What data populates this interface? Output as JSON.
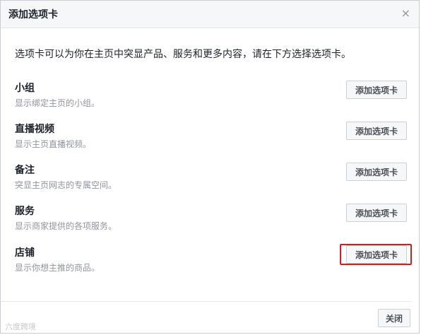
{
  "dialog": {
    "title": "添加选项卡",
    "close_glyph": "×",
    "intro": "选项卡可以为你在主页中突显产品、服务和更多内容，请在下方选择选项卡。",
    "tabs": [
      {
        "title": "小组",
        "description": "显示绑定主页的小组。",
        "button": "添加选项卡"
      },
      {
        "title": "直播视频",
        "description": "显示主页直播视频。",
        "button": "添加选项卡"
      },
      {
        "title": "备注",
        "description": "突显主页网志的专属空间。",
        "button": "添加选项卡"
      },
      {
        "title": "服务",
        "description": "显示商家提供的各项服务。",
        "button": "添加选项卡"
      },
      {
        "title": "店铺",
        "description": "显示你想主推的商品。",
        "button": "添加选项卡"
      }
    ],
    "close_button": "关闭"
  },
  "watermark": "六度跨境",
  "colors": {
    "header_bg": "#f6f7f9",
    "border": "#c9ccd1",
    "text": "#1d2129",
    "secondary_text": "#90949c",
    "highlight": "#d0201e"
  }
}
